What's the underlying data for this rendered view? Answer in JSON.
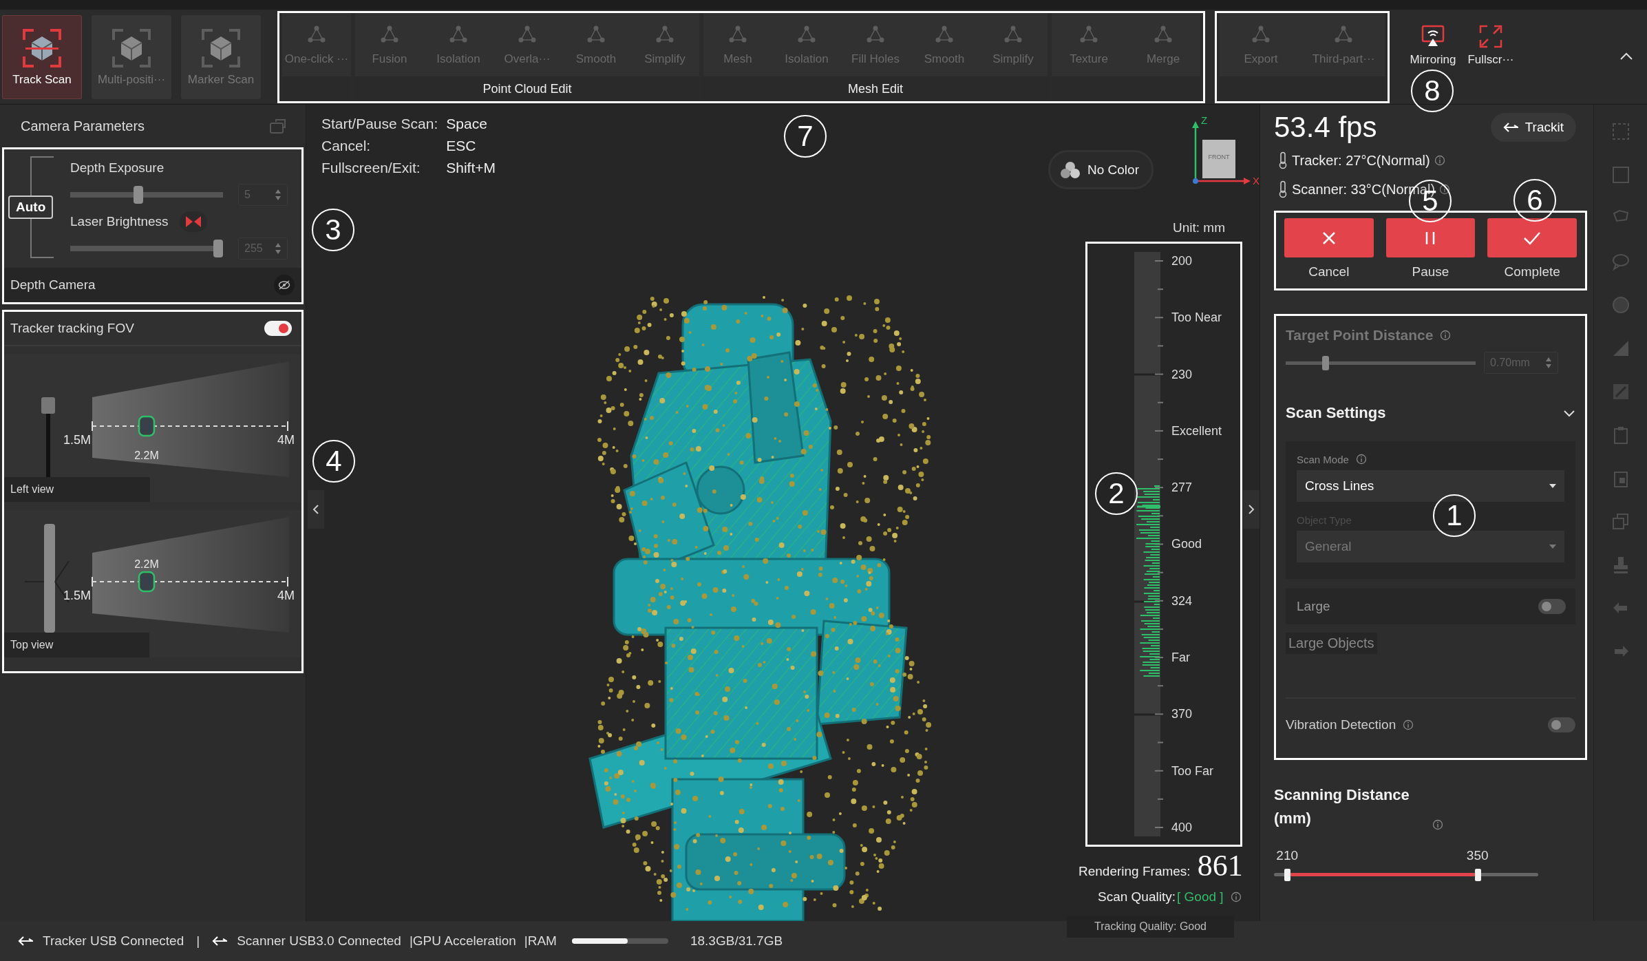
{
  "toolbar": {
    "modes": [
      {
        "label": "Track Scan",
        "selected": true
      },
      {
        "label": "Multi-positi···",
        "selected": false
      },
      {
        "label": "Marker Scan",
        "selected": false
      }
    ],
    "sections": [
      {
        "outlined": true,
        "groups": [
          {
            "tools": [
              {
                "label": "One-click ···",
                "disabled": true
              }
            ]
          },
          {
            "title": "Point Cloud Edit",
            "tools": [
              {
                "label": "Fusion",
                "disabled": true
              },
              {
                "label": "Isolation",
                "disabled": true
              },
              {
                "label": "Overla···",
                "disabled": true
              },
              {
                "label": "Smooth",
                "disabled": true
              },
              {
                "label": "Simplify",
                "disabled": true
              }
            ]
          },
          {
            "title": "Mesh Edit",
            "tools": [
              {
                "label": "Mesh",
                "disabled": true
              },
              {
                "label": "Isolation",
                "disabled": true
              },
              {
                "label": "Fill Holes",
                "disabled": true
              },
              {
                "label": "Smooth",
                "disabled": true
              },
              {
                "label": "Simplify",
                "disabled": true
              }
            ]
          },
          {
            "tools": [
              {
                "label": "Texture",
                "disabled": true
              },
              {
                "label": "Merge",
                "disabled": true
              }
            ]
          }
        ]
      },
      {
        "outlined": true,
        "groups": [
          {
            "tools": [
              {
                "label": "Export",
                "disabled": true
              },
              {
                "label": "Third-part···",
                "disabled": true
              }
            ]
          }
        ]
      },
      {
        "outlined": false,
        "groups": [
          {
            "tools": [
              {
                "label": "Mirroring",
                "disabled": false
              },
              {
                "label": "Fullscr···",
                "disabled": false
              }
            ]
          }
        ]
      }
    ]
  },
  "left_panel": {
    "title": "Camera Parameters",
    "camera": {
      "outlined": true,
      "auto": "Auto",
      "sliders": [
        {
          "label": "Depth Exposure",
          "level": 0.44,
          "value": "5"
        },
        {
          "label": "Laser Brightness",
          "level": 1,
          "value": "255"
        }
      ],
      "footer": "Depth Camera"
    },
    "tracker_fov": {
      "outlined": true,
      "title": "Tracker tracking FOV",
      "on": true,
      "views": [
        {
          "caption": "Left view",
          "near": "1.5M",
          "mid": "2.2M",
          "far": "4M"
        },
        {
          "caption": "Top view",
          "near": "1.5M",
          "mid": "2.2M",
          "far": "4M"
        }
      ]
    }
  },
  "viewport": {
    "shortcuts": [
      {
        "action": "Start/Pause Scan:",
        "key": "Space"
      },
      {
        "action": "Cancel:",
        "key": "ESC"
      },
      {
        "action": "Fullscreen/Exit:",
        "key": "Shift+M"
      }
    ],
    "color_mode": "No Color",
    "axes": {
      "z": "Z",
      "x": "X",
      "face": "FRONT"
    },
    "distance_meter": {
      "outlined": true,
      "unit": "Unit: mm",
      "labels": [
        "200",
        "Too Near",
        "230",
        "Excellent",
        "277",
        "Good",
        "324",
        "Far",
        "370",
        "Too Far",
        "400"
      ]
    },
    "rendering_frames": {
      "label": "Rendering Frames:",
      "value": "861"
    },
    "scan_quality": {
      "label": "Scan Quality:",
      "value": "[ Good ]"
    },
    "tracking_quality": "Tracking Quality: Good"
  },
  "right_panel": {
    "fps": "53.4 fps",
    "trackit": "Trackit",
    "temperatures": [
      "Tracker: 27°C(Normal)",
      "Scanner: 33°C(Normal)"
    ],
    "actions": {
      "outlined": true,
      "buttons": [
        "Cancel",
        "Pause",
        "Complete"
      ]
    },
    "settings": {
      "outlined": true,
      "target_point_distance": {
        "label": "Target Point Distance",
        "disabled": true,
        "level": 0.2,
        "value": "0.70mm"
      },
      "scan_settings": {
        "title": "Scan Settings",
        "expanded": true,
        "scan_mode": {
          "label": "Scan Mode",
          "value": "Cross Lines"
        },
        "object_type": {
          "label": "Object Type",
          "value": "General",
          "disabled": true
        },
        "large": {
          "label": "Large",
          "on": false
        },
        "large_hint": "Large Objects"
      },
      "vibration_detection": {
        "label": "Vibration Detection",
        "on": false
      }
    },
    "scanning_distance": {
      "title": "Scanning Distance (mm)",
      "handles": [
        {
          "label": "210",
          "level": 0.05
        },
        {
          "label": "350",
          "level": 0.77
        }
      ]
    }
  },
  "status_bar": {
    "tracker": "Tracker USB Connected",
    "separator": "|",
    "scanner": "Scanner USB3.0 Connected",
    "gpu": "|GPU Acceleration",
    "ram_label": "|RAM",
    "ram": {
      "level": 0.58
    },
    "ram_text": "18.3GB/31.7GB"
  },
  "callouts": [
    {
      "label": "1"
    },
    {
      "label": "2"
    },
    {
      "label": "3"
    },
    {
      "label": "4"
    },
    {
      "label": "5"
    },
    {
      "label": "6"
    },
    {
      "label": "7"
    },
    {
      "label": "8"
    }
  ]
}
